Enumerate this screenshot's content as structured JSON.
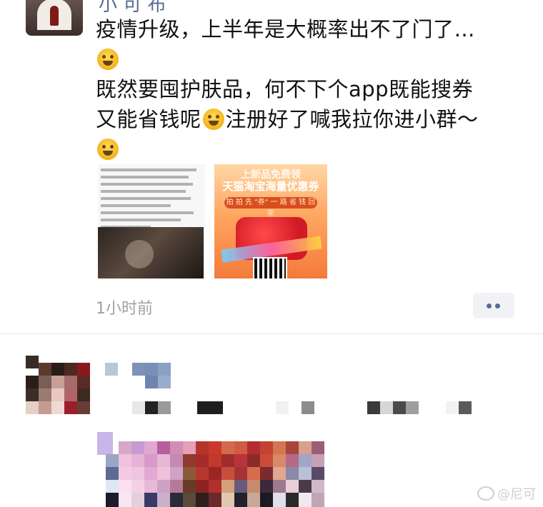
{
  "post": {
    "author": "小 可 布",
    "lines": [
      "疫情升级，上半年是大概率出不了门了…",
      "既然要囤护肤品，何不下个app既能搜券",
      "又能省钱呢",
      "注册好了喊我拉你进小群～"
    ],
    "emojis": [
      "laugh-cry-emoji",
      "thinking-emoji",
      "smirk-emoji"
    ],
    "timestamp": "1小时前"
  },
  "attachments": {
    "image_2": {
      "line1": "上新品免费领",
      "line2": "天猫淘宝海量优惠券",
      "line3": "拍 拍 先 \"券\" 一 路 省 钱 回 家"
    }
  },
  "watermark": "@尼可",
  "colors": {
    "link_blue": "#566b94",
    "timestamp_gray": "#a0a0a0",
    "divider": "#e5e5e5"
  }
}
